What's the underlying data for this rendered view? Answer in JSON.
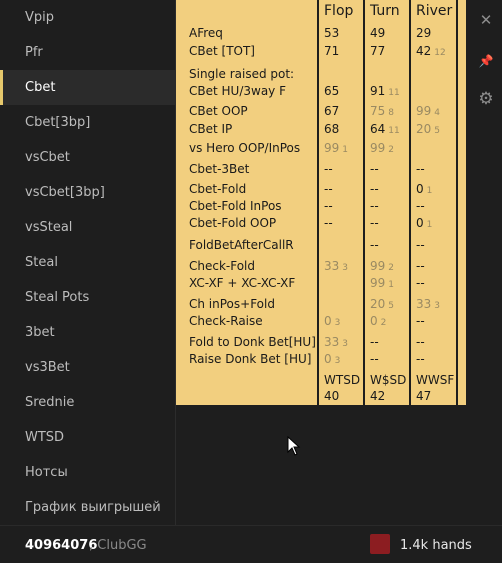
{
  "sidebar": {
    "items": [
      {
        "label": "Vpip"
      },
      {
        "label": "Pfr"
      },
      {
        "label": "Cbet",
        "active": true
      },
      {
        "label": "Cbet[3bp]"
      },
      {
        "label": "vsCbet"
      },
      {
        "label": "vsCbet[3bp]"
      },
      {
        "label": "vsSteal"
      },
      {
        "label": "Steal"
      },
      {
        "label": "Steal Pots"
      },
      {
        "label": "3bet"
      },
      {
        "label": "vs3Bet"
      },
      {
        "label": "Srednie"
      },
      {
        "label": "WTSD"
      },
      {
        "label": "Нотсы"
      },
      {
        "label": "График выигрышей"
      }
    ]
  },
  "table": {
    "headers": [
      "Flop",
      "Turn",
      "River"
    ],
    "rows": [
      {
        "label": "AFreq",
        "flop": "53",
        "turn": "49",
        "river": "29"
      },
      {
        "label": "CBet [TOT]",
        "flop": "71",
        "turn": "77",
        "river": "42",
        "river_n": "12"
      },
      {
        "label": "Single raised pot:"
      },
      {
        "label": "CBet HU/3way F",
        "flop": "65",
        "turn": "91",
        "turn_n": "11"
      },
      {
        "label": "CBet OOP",
        "flop": "67",
        "turn": "75",
        "turn_n": "8",
        "turn_dim": true,
        "river": "99",
        "river_n": "4",
        "river_dim": true
      },
      {
        "label": "CBet IP",
        "flop": "68",
        "turn": "64",
        "turn_n": "11",
        "river": "20",
        "river_n": "5",
        "river_dim": true
      },
      {
        "label": "vs Hero OOP/InPos",
        "flop": "99",
        "flop_n": "1",
        "flop_dim": true,
        "turn": "99",
        "turn_n": "2",
        "turn_dim": true
      },
      {
        "label": "Cbet-3Bet",
        "flop": "--",
        "turn": "--",
        "river": "--"
      },
      {
        "label": "Cbet-Fold",
        "flop": "--",
        "turn": "--",
        "river": "0",
        "river_n": "1"
      },
      {
        "label": "Cbet-Fold InPos",
        "flop": "--",
        "turn": "--",
        "river": "--"
      },
      {
        "label": "Cbet-Fold OOP",
        "flop": "--",
        "turn": "--",
        "river": "0",
        "river_n": "1"
      },
      {
        "label": "FoldBetAfterCallR",
        "turn": "--",
        "river": "--"
      },
      {
        "label": "Check-Fold",
        "flop": "33",
        "flop_n": "3",
        "flop_dim": true,
        "turn": "99",
        "turn_n": "2",
        "turn_dim": true,
        "river": "--"
      },
      {
        "label": "XC-XF + XC-XC-XF",
        "turn": "99",
        "turn_n": "1",
        "turn_dim": true,
        "river": "--"
      },
      {
        "label": "Ch inPos+Fold",
        "turn": "20",
        "turn_n": "5",
        "turn_dim": true,
        "river": "33",
        "river_n": "3",
        "river_dim": true
      },
      {
        "label": "Check-Raise",
        "flop": "0",
        "flop_n": "3",
        "flop_dim": true,
        "turn": "0",
        "turn_n": "2",
        "turn_dim": true,
        "river": "--"
      },
      {
        "label": "Fold to Donk Bet[HU]",
        "flop": "33",
        "flop_n": "3",
        "flop_dim": true,
        "turn": "--",
        "river": "--"
      },
      {
        "label": "Raise Donk Bet [HU]",
        "flop": "0",
        "flop_n": "3",
        "flop_dim": true,
        "turn": "--",
        "river": "--"
      }
    ],
    "bottom": {
      "labels": [
        "WTSD",
        "W$SD",
        "WWSF"
      ],
      "values": [
        "40",
        "42",
        "47"
      ]
    }
  },
  "icons": {
    "close": "✕",
    "pin": "📌",
    "settings": "⚙"
  },
  "footer": {
    "player_id": "40964076",
    "room": ", ClubGG",
    "hands": "1.4k hands",
    "swatch_color": "#8c1d21"
  }
}
